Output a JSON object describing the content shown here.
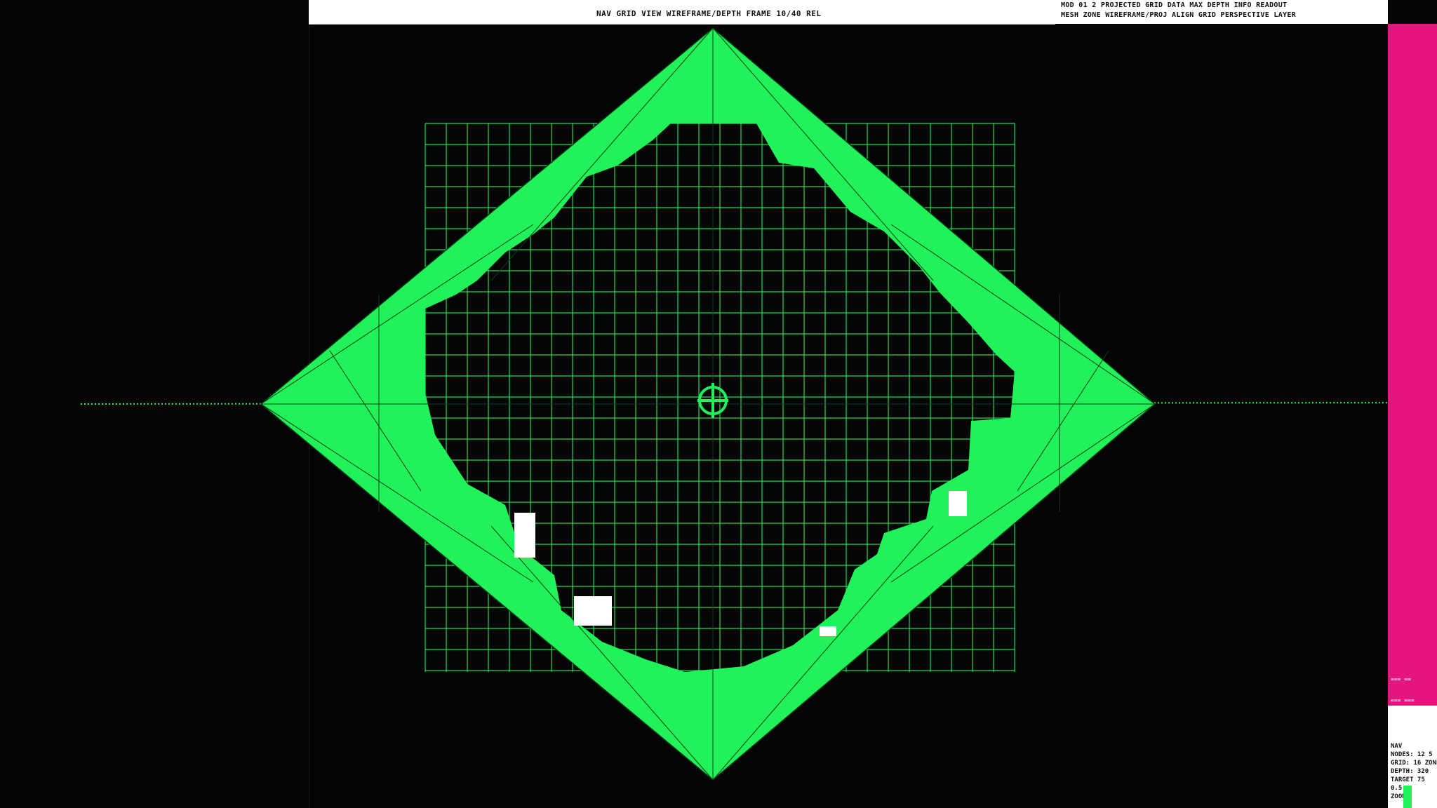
{
  "header": {
    "title": "NAV GRID VIEW  WIREFRAME/DEPTH   FRAME 10/40 REL",
    "right_lines": [
      "MOD 01 2    PROJECTED GRID DATA   MAX  DEPTH INFO  READOUT",
      "MESH ZONE   WIREFRAME/PROJ ALIGN  GRID  PERSPECTIVE  LAYER"
    ]
  },
  "side_panel": {
    "magenta_text": [
      "=== ==",
      "=== ===",
      "== ===",
      "=== =="
    ],
    "legend_lines": [
      "NAV",
      "NODES: 12 5",
      "GRID: 16 ZONE",
      "DEPTH: 320",
      "TARGET  75",
      "0.5",
      "ZOOM"
    ]
  },
  "colors": {
    "grid_green": "#22f25a",
    "accent_magenta": "#e6147e",
    "background": "#050505"
  },
  "icons": {
    "crosshair": "target-crosshair-icon"
  }
}
